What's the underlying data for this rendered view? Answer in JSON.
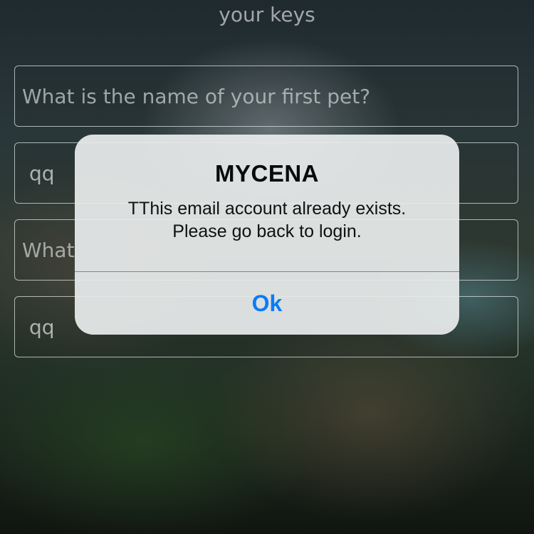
{
  "background": {
    "heading_partial": "your keys"
  },
  "form": {
    "question_1_placeholder": "What is the name of your first pet?",
    "answer_1_value": "qq",
    "question_2_placeholder": "What",
    "answer_2_value": "qq"
  },
  "alert": {
    "title": "MYCENA",
    "message_line_1": "TThis email account already exists.",
    "message_line_2": "Please go back to login.",
    "ok_label": "Ok"
  },
  "colors": {
    "alert_button_text": "#0a7cf6",
    "alert_background": "#e8ecec",
    "field_border": "#dce1e1"
  },
  "icons": []
}
